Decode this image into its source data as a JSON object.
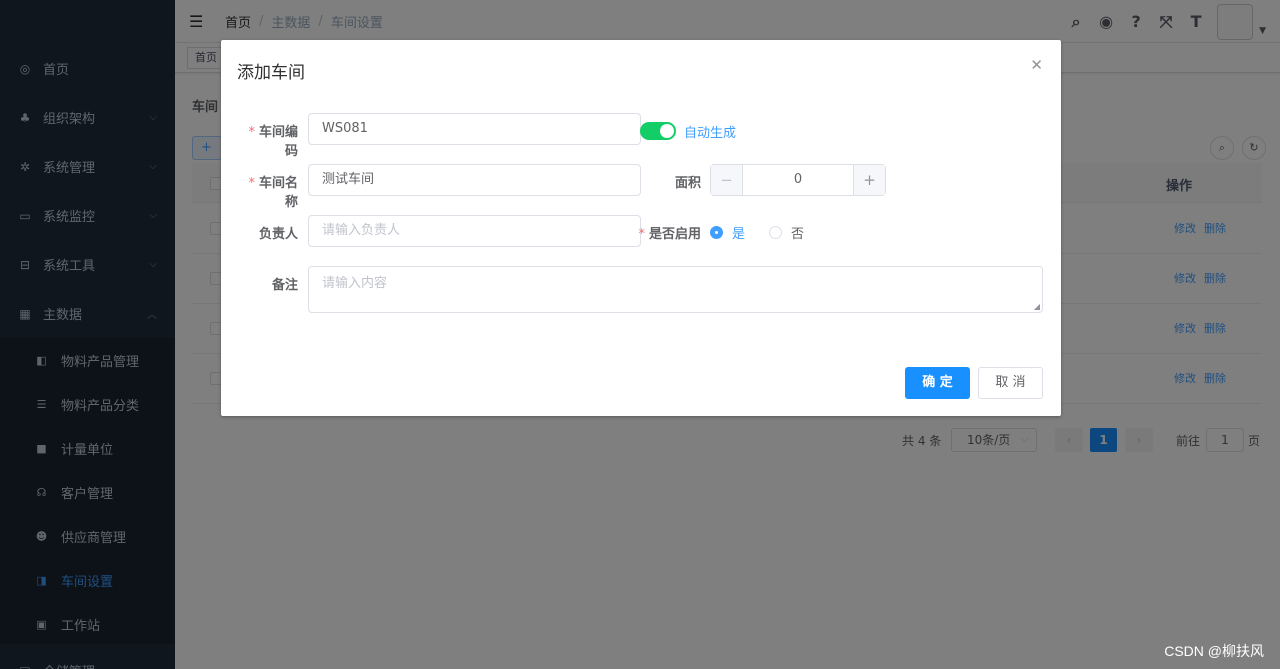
{
  "sidebar": {
    "items": [
      {
        "label": "首页",
        "icon": "dashboard-icon",
        "glyph": "◎"
      },
      {
        "label": "组织架构",
        "icon": "tree-icon",
        "glyph": "♣"
      },
      {
        "label": "系统管理",
        "icon": "gear-icon",
        "glyph": "✲"
      },
      {
        "label": "系统监控",
        "icon": "monitor-icon",
        "glyph": "▭"
      },
      {
        "label": "系统工具",
        "icon": "toolbox-icon",
        "glyph": "⊟"
      },
      {
        "label": "主数据",
        "icon": "grid-icon",
        "glyph": "▦"
      }
    ],
    "submenu": [
      {
        "label": "物料产品管理",
        "icon": "book-icon",
        "glyph": "◧"
      },
      {
        "label": "物料产品分类",
        "icon": "list-icon",
        "glyph": "☰"
      },
      {
        "label": "计量单位",
        "icon": "folder-icon",
        "glyph": "■"
      },
      {
        "label": "客户管理",
        "icon": "headset-icon",
        "glyph": "☊"
      },
      {
        "label": "供应商管理",
        "icon": "users-icon",
        "glyph": "☻"
      },
      {
        "label": "车间设置",
        "icon": "workshop-icon",
        "glyph": "◨",
        "active": true
      },
      {
        "label": "工作站",
        "icon": "station-icon",
        "glyph": "▣"
      }
    ],
    "bottom_partial": "仓储管理"
  },
  "navbar": {
    "breadcrumb": [
      "首页",
      "主数据",
      "车间设置"
    ],
    "icons": [
      "search-icon",
      "github-icon",
      "help-icon",
      "fullscreen-icon",
      "font-size-icon"
    ]
  },
  "tags": {
    "first": "首页"
  },
  "page": {
    "title": "车间",
    "add_label": "+",
    "ops_header": "操作",
    "row_edit": "修改",
    "row_delete": "删除"
  },
  "pager": {
    "total": "共 4 条",
    "page_size": "10条/页",
    "current": "1",
    "goto": "前往",
    "goto_value": "1",
    "page_suffix": "页"
  },
  "dialog": {
    "title": "添加车间",
    "code_label": "车间编码",
    "code_value": "WS081",
    "auto_label": "自动生成",
    "auto_on": true,
    "name_label": "车间名称",
    "name_value": "测试车间",
    "area_label": "面积",
    "area_value": "0",
    "owner_label": "负责人",
    "owner_placeholder": "请输入负责人",
    "enabled_label": "是否启用",
    "yes": "是",
    "no": "否",
    "remark_label": "备注",
    "remark_placeholder": "请输入内容",
    "ok": "确 定",
    "cancel": "取 消"
  },
  "watermark": "CSDN @柳扶风",
  "colors": {
    "primary": "#1890ff",
    "switch_on": "#13ce66",
    "sidebar_bg": "#1f2d3d",
    "required": "#f56c6c"
  }
}
